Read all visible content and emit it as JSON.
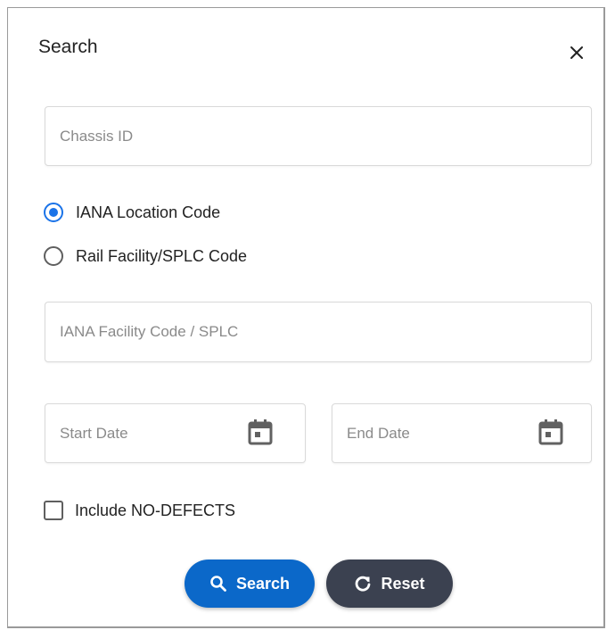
{
  "dialog": {
    "title": "Search",
    "close_icon": "close-icon"
  },
  "chassis": {
    "placeholder": "Chassis ID",
    "value": ""
  },
  "location_type": {
    "options": [
      {
        "label": "IANA Location Code",
        "selected": true
      },
      {
        "label": "Rail Facility/SPLC Code",
        "selected": false
      }
    ]
  },
  "facility": {
    "placeholder": "IANA Facility Code / SPLC",
    "value": ""
  },
  "start_date": {
    "placeholder": "Start Date",
    "value": "",
    "icon": "calendar-icon"
  },
  "end_date": {
    "placeholder": "End Date",
    "value": "",
    "icon": "calendar-icon"
  },
  "include_no_defects": {
    "label": "Include NO-DEFECTS",
    "checked": false
  },
  "actions": {
    "search_label": "Search",
    "search_icon": "search-icon",
    "reset_label": "Reset",
    "reset_icon": "reset-icon"
  },
  "colors": {
    "primary": "#0b68c9",
    "secondary": "#3b4150",
    "radio_accent": "#1a73e8"
  }
}
